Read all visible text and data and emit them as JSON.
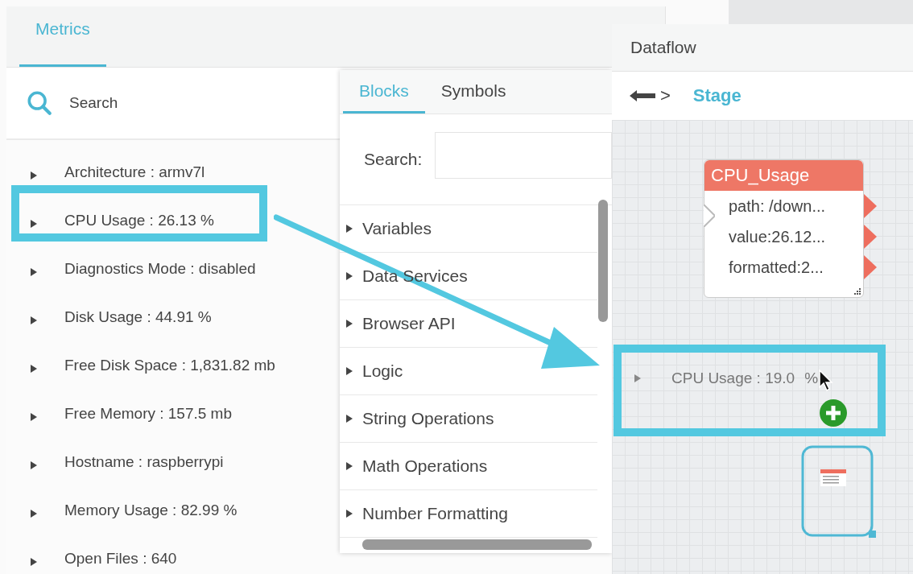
{
  "metrics_panel": {
    "tabs": [
      {
        "label": "Metrics",
        "selected": true
      }
    ],
    "search": {
      "placeholder": "Search"
    },
    "items": [
      {
        "label": "Architecture : armv7l",
        "expanded": false
      },
      {
        "label": "CPU Usage : 26.13 %",
        "expanded": false
      },
      {
        "label": "Diagnostics Mode : disabled",
        "expanded": false
      },
      {
        "label": "Disk Usage : 44.91 %",
        "expanded": false
      },
      {
        "label": "Free Disk Space : 1,831.82 mb",
        "expanded": false
      },
      {
        "label": "Free Memory : 157.5 mb",
        "expanded": false
      },
      {
        "label": "Hostname : raspberrypi",
        "expanded": false
      },
      {
        "label": "Memory Usage : 82.99 %",
        "expanded": false
      },
      {
        "label": "Open Files : 640",
        "expanded": false
      }
    ]
  },
  "blocks_panel": {
    "tabs": [
      {
        "label": "Blocks",
        "selected": true
      },
      {
        "label": "Symbols",
        "selected": false
      }
    ],
    "search_label": "Search:",
    "categories": [
      {
        "label": "Variables",
        "expanded": false
      },
      {
        "label": "Data Services",
        "expanded": false
      },
      {
        "label": "Browser API",
        "expanded": false
      },
      {
        "label": "Logic",
        "expanded": false
      },
      {
        "label": "String Operations",
        "expanded": false
      },
      {
        "label": "Math Operations",
        "expanded": false
      },
      {
        "label": "Number Formatting",
        "expanded": false
      }
    ]
  },
  "dataflow": {
    "title": "Dataflow",
    "breadcrumb": {
      "separator": ">",
      "current": "Stage"
    },
    "node": {
      "title": "CPU_Usage",
      "ports": [
        "path: /down...",
        "value:26.12...",
        "formatted:2..."
      ]
    },
    "drag_item": {
      "label": "CPU Usage : 19.0",
      "suffix": "%"
    }
  }
}
